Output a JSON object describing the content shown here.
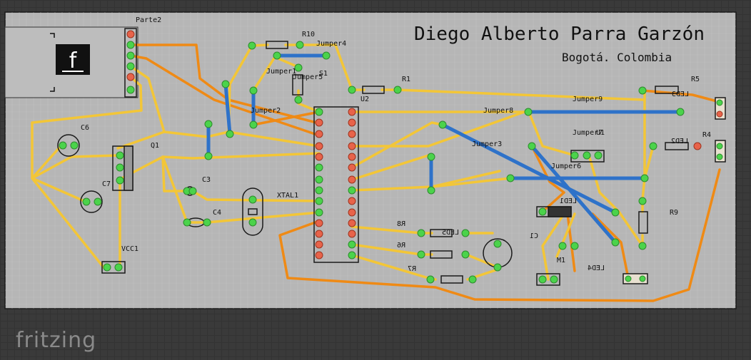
{
  "app": {
    "brand": "fritzing"
  },
  "board": {
    "title": "Diego Alberto Parra Garzón",
    "subtitle": "Bogotá. Colombia",
    "colors": {
      "board": "#b6b6b6",
      "top_trace": "#f3c637",
      "bottom_trace": "#ef8a15",
      "jumper": "#2e72c9",
      "pad_green": "#4bd34b",
      "pad_red": "#e8634a"
    }
  },
  "labels": {
    "parte2": "Parte2",
    "r10": "R10",
    "jumper4": "Jumper4",
    "jumper1": "Jumper1",
    "s1": "S1",
    "jumper5": "Jumper5",
    "r1": "R1",
    "u2": "U2",
    "jumper2": "Jumper2",
    "c6": "C6",
    "q1": "Q1",
    "c7": "C7",
    "c3": "C3",
    "c4": "C4",
    "xtal1": "XTAL1",
    "vcc1": "VCC1",
    "jumper8": "Jumper8",
    "jumper9": "Jumper9",
    "jumper7": "Jumper7",
    "u1": "U1",
    "jumper3": "Jumper3",
    "jumper6": "Jumper6",
    "r5": "R5",
    "led3": "LED3",
    "r4": "R4",
    "led2": "LED2",
    "led1": "LED1",
    "led5": "LED5",
    "r9": "R9",
    "r8": "R8",
    "r6": "R6",
    "r7": "R7",
    "c1": "C1",
    "m1": "M1",
    "led4": "LED4"
  }
}
